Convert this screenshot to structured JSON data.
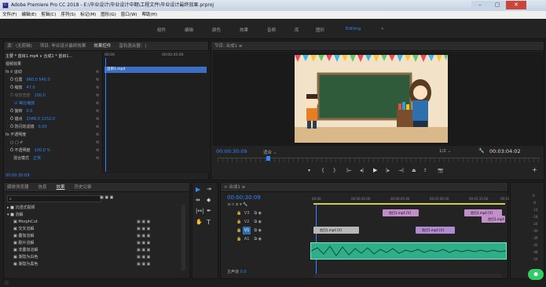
{
  "titlebar": {
    "title": "Adobe Premiere Pro CC 2018 - E:\\毕业设计\\毕业设计中期\\工程文件\\毕业设计最终效果.prproj",
    "icon_text": "Pr"
  },
  "menu": [
    "文件(F)",
    "编辑(E)",
    "剪辑(C)",
    "序列(S)",
    "标记(M)",
    "图形(G)",
    "窗口(W)",
    "帮助(H)"
  ],
  "workspaces": [
    "组件",
    "编辑",
    "颜色",
    "效果",
    "音频",
    "库",
    "图形",
    "Editing",
    "»"
  ],
  "workspace_active": "Editing",
  "effect_controls": {
    "tabs": [
      "源：(无剪辑)",
      "项目: 毕业设计最终效果",
      "效果控件",
      "音轨混合器：("
    ],
    "clip_header": "主要 * 首目1.mp4 ∨ 合成1 * 首目1...",
    "clip_label": "首目1.mp4",
    "time_start": "00:00",
    "time_end": "00:00:45:00",
    "section_video": "视频效果",
    "rows": [
      {
        "label": "fx  ⌾ 运动",
        "value": "",
        "indent": 2
      },
      {
        "label": "Ö 位置",
        "value": "960.0    540.0",
        "indent": 8
      },
      {
        "label": "Ö 缩放",
        "value": "47.0",
        "indent": 8
      },
      {
        "label": "Ö 缩放宽度",
        "value": "100.0",
        "indent": 8,
        "dim": true
      },
      {
        "label": "",
        "value": "☑ 等比缩放",
        "indent": 8
      },
      {
        "label": "Ö 旋转",
        "value": "0.0",
        "indent": 8
      },
      {
        "label": "Ö 锚点",
        "value": "2048.0    1152.0",
        "indent": 8
      },
      {
        "label": "Ö 防闪烁滤镜",
        "value": "0.00",
        "indent": 8
      },
      {
        "label": "fx  不透明度",
        "value": "",
        "indent": 2
      },
      {
        "label": "○ ▢ ✐",
        "value": "",
        "indent": 8
      },
      {
        "label": "Ö 不透明度",
        "value": "100.0 %",
        "indent": 8
      },
      {
        "label": "混合模式",
        "value": "正常",
        "indent": 12
      }
    ],
    "timecode": "00:00:30:09"
  },
  "program": {
    "title": "节目: 合成1",
    "timecode": "00:00:30:09",
    "fit": "适合",
    "ratio": "1/2",
    "duration": "00:03:04:02"
  },
  "effects_panel": {
    "tabs": [
      "媒体浏览器",
      "信息",
      "效果",
      "历史记录"
    ],
    "active_tab": "效果",
    "tree": [
      {
        "label": "▸ ■ 沉浸式视频",
        "indent": 0
      },
      {
        "label": "▾ ■ 溶解",
        "indent": 0
      },
      {
        "label": "▣ MorphCut",
        "indent": 8
      },
      {
        "label": "▣ 交叉溶解",
        "indent": 8
      },
      {
        "label": "▣ 叠加溶解",
        "indent": 8
      },
      {
        "label": "▣ 胶片溶解",
        "indent": 8
      },
      {
        "label": "▣ 非叠加溶解",
        "indent": 8
      },
      {
        "label": "▣ 渐隐为白色",
        "indent": 8
      },
      {
        "label": "▣ 渐隐为黑色",
        "indent": 8
      }
    ]
  },
  "timeline": {
    "title": "合成1",
    "timecode": "00:00:30:09",
    "ruler": [
      "00:00",
      "00:00:30:00",
      "00:00:45:00",
      "00:01:00:00",
      "00:01:15:00",
      "00:01:30:00"
    ],
    "tracks": [
      "V3",
      "V2",
      "V1",
      "A1"
    ],
    "clips": [
      {
        "label": "首目1.mp4 [V]",
        "color": "#c18ec9"
      },
      {
        "label": "首目1.mp4 [V]",
        "color": "#c18ec9"
      },
      {
        "label": "首目1.mp4 [V]",
        "color": "#c18ec9"
      },
      {
        "label": "首目1.mp4 [V]",
        "color": "#b7b7b7"
      },
      {
        "label": "首目1.mp4 [V]",
        "color": "#b18ad0"
      }
    ],
    "master": "主声道",
    "master_val": "0.0"
  },
  "meter": [
    "0",
    "-6",
    "-12",
    "-18",
    "-24",
    "-30",
    "-36",
    "-42",
    "-48",
    "-54"
  ]
}
